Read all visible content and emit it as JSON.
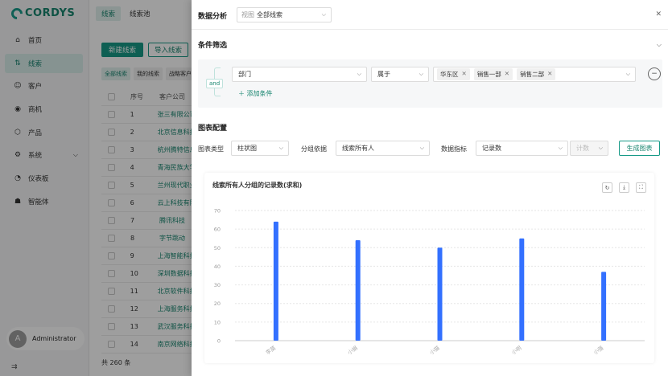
{
  "app": {
    "logo": "CORDYS"
  },
  "sidebar": {
    "items": [
      {
        "label": "首页",
        "icon": "home-icon",
        "active": false
      },
      {
        "label": "线索",
        "icon": "lead-icon",
        "active": true
      },
      {
        "label": "客户",
        "icon": "customer-icon",
        "active": false
      },
      {
        "label": "商机",
        "icon": "opportunity-icon",
        "active": false
      },
      {
        "label": "产品",
        "icon": "product-icon",
        "active": false
      },
      {
        "label": "系统",
        "icon": "settings-icon",
        "active": false
      },
      {
        "label": "仪表板",
        "icon": "dashboard-icon",
        "active": false
      },
      {
        "label": "智能体",
        "icon": "agent-icon",
        "active": false
      }
    ],
    "user": {
      "initial": "A",
      "name": "Administrator"
    }
  },
  "main": {
    "tabs": [
      "线索",
      "线索池"
    ],
    "new_button": "新建线索",
    "import_button": "导入线索",
    "filter_chips": [
      "全部线索",
      "我的线索",
      "战略客户"
    ],
    "columns": [
      "序号",
      "客户公司"
    ],
    "rows": [
      {
        "no": "1",
        "company": "张三有限公司"
      },
      {
        "no": "2",
        "company": "北京信息科技"
      },
      {
        "no": "3",
        "company": "杭州腾特信息"
      },
      {
        "no": "4",
        "company": "青海民族大学"
      },
      {
        "no": "5",
        "company": "兰州现代职业"
      },
      {
        "no": "6",
        "company": "云上科技有限"
      },
      {
        "no": "7",
        "company": "腾讯科技"
      },
      {
        "no": "8",
        "company": "字节跳动"
      },
      {
        "no": "9",
        "company": "上海智能科技"
      },
      {
        "no": "10",
        "company": "深圳数据科技"
      },
      {
        "no": "11",
        "company": "北京软件科技"
      },
      {
        "no": "12",
        "company": "上海服务科技"
      },
      {
        "no": "13",
        "company": "武汉服务科技"
      },
      {
        "no": "14",
        "company": "南京网络科技"
      }
    ],
    "total": "共 260 条"
  },
  "drawer": {
    "title": "数据分析",
    "view_prefix": "视图",
    "view_value": "全部线索",
    "filter_title": "条件筛选",
    "and_label": "and",
    "condition": {
      "field": "部门",
      "operator": "属于",
      "tags": [
        "华东区",
        "销售一部",
        "销售二部"
      ]
    },
    "add_condition": "添加条件",
    "config_title": "图表配置",
    "chart_type_label": "图表类型",
    "chart_type_value": "柱状图",
    "group_label": "分组依据",
    "group_value": "线索所有人",
    "metric_label": "数据指标",
    "metric_value": "记录数",
    "agg_value": "计数",
    "generate_button": "生成图表"
  },
  "chart_data": {
    "type": "bar",
    "title": "线索所有人分组的记录数(求和)",
    "categories": [
      "李莫",
      "小娟",
      "小猫",
      "小明",
      "小强"
    ],
    "values": [
      64,
      54,
      50,
      55,
      37
    ],
    "ylim": [
      0,
      70
    ],
    "yticks": [
      "0",
      "10",
      "20",
      "30",
      "40",
      "50",
      "60",
      "70"
    ],
    "grid": true,
    "bar_color": "#3370ff"
  }
}
